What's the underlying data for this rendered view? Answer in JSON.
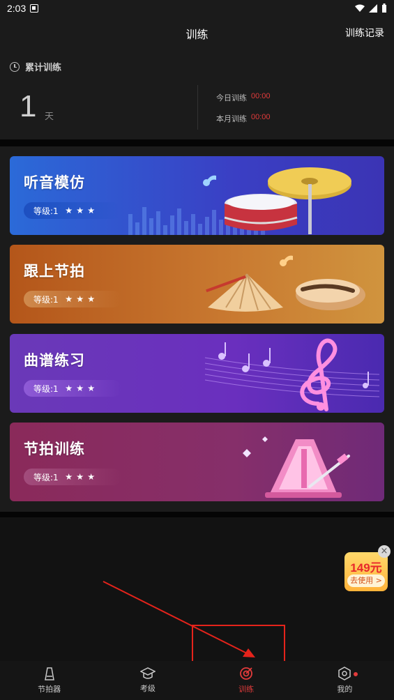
{
  "status_bar": {
    "time": "2:03"
  },
  "header": {
    "title": "训练",
    "right_action": "训练记录"
  },
  "stats": {
    "heading": "累计训练",
    "days_value": "1",
    "days_unit": "天",
    "today_label": "今日训练",
    "today_value": "00:00",
    "month_label": "本月训练",
    "month_value": "00:00"
  },
  "cards": [
    {
      "title": "听音模仿",
      "level": "等级:1",
      "stars": 3,
      "icon": "drum-cymbal-icon"
    },
    {
      "title": "跟上节拍",
      "level": "等级:1",
      "stars": 3,
      "icon": "woodblock-icon"
    },
    {
      "title": "曲谱练习",
      "level": "等级:1",
      "stars": 3,
      "icon": "treble-clef-icon"
    },
    {
      "title": "节拍训练",
      "level": "等级:1",
      "stars": 3,
      "icon": "metronome-icon"
    }
  ],
  "coupon": {
    "price": "149元",
    "action": "去使用 >"
  },
  "bottom_nav": [
    {
      "label": "节拍器",
      "icon": "metronome-icon",
      "active": false
    },
    {
      "label": "考级",
      "icon": "graduation-cap-icon",
      "active": false
    },
    {
      "label": "训练",
      "icon": "target-icon",
      "active": true
    },
    {
      "label": "我的",
      "icon": "hexagon-settings-icon",
      "active": false
    }
  ],
  "colors": {
    "accent": "#e23b3b",
    "background": "#121212",
    "surface": "#1b1b1b"
  }
}
